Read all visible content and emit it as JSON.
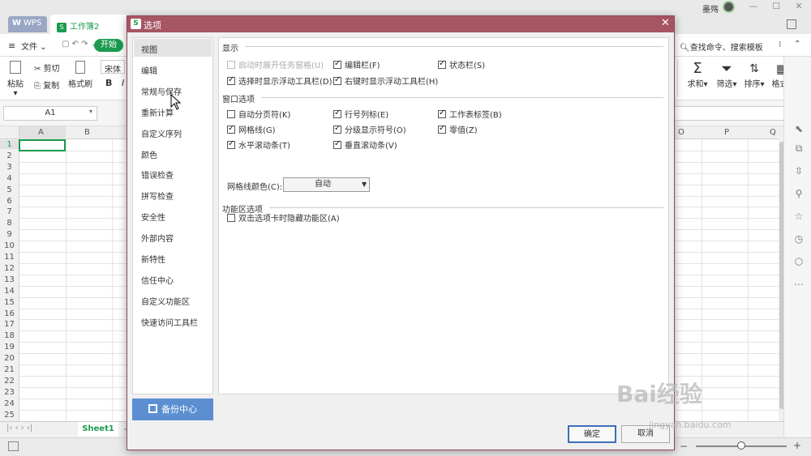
{
  "app": {
    "tab_wps": "WPS",
    "tab_workbook": "工作簿2",
    "user_name": "墨殇"
  },
  "menubar": {
    "file_label": "文件",
    "start_tab": "开始",
    "search_label": "查找命令、搜索模板"
  },
  "ribbon": {
    "paste": "粘贴",
    "cut": "剪切",
    "copy": "复制",
    "format_painter": "格式刷",
    "font_name": "宋体",
    "bold": "B",
    "italic": "I",
    "sum": "求和",
    "filter": "筛选",
    "sort": "排序",
    "format": "格式"
  },
  "formula_bar": {
    "cell_ref": "A1"
  },
  "grid": {
    "columns": [
      "A",
      "B",
      "O",
      "P",
      "Q"
    ],
    "rows": [
      "1",
      "2",
      "3",
      "4",
      "5",
      "6",
      "7",
      "8",
      "9",
      "10",
      "11",
      "12",
      "13",
      "14",
      "15",
      "16",
      "17",
      "18",
      "19",
      "20",
      "21",
      "22",
      "23",
      "24",
      "25"
    ]
  },
  "sheets": {
    "active": "Sheet1"
  },
  "dialog": {
    "title": "选项",
    "nav_items": [
      "视图",
      "编辑",
      "常规与保存",
      "重新计算",
      "自定义序列",
      "颜色",
      "错误检查",
      "拼写检查",
      "安全性",
      "外部内容",
      "新特性",
      "信任中心",
      "自定义功能区",
      "快速访问工具栏"
    ],
    "active_nav": "视图",
    "backup_label": "备份中心",
    "section_display": "显示",
    "section_window": "窗口选项",
    "section_ribbon": "功能区选项",
    "display_options": [
      {
        "label": "启动时展开任务窗格(U)",
        "checked": false,
        "disabled": true
      },
      {
        "label": "编辑栏(F)",
        "checked": true
      },
      {
        "label": "状态栏(S)",
        "checked": true
      },
      {
        "label": "选择时显示浮动工具栏(D)",
        "checked": true
      },
      {
        "label": "右键时显示浮动工具栏(H)",
        "checked": true
      }
    ],
    "window_options": [
      {
        "label": "自动分页符(K)",
        "checked": false
      },
      {
        "label": "行号列标(E)",
        "checked": true
      },
      {
        "label": "工作表标签(B)",
        "checked": true
      },
      {
        "label": "网格线(G)",
        "checked": true
      },
      {
        "label": "分级显示符号(O)",
        "checked": true
      },
      {
        "label": "零值(Z)",
        "checked": true
      },
      {
        "label": "水平滚动条(T)",
        "checked": true
      },
      {
        "label": "垂直滚动条(V)",
        "checked": true
      }
    ],
    "gridline_color_label": "网格线颜色(C):",
    "gridline_color_value": "自动",
    "ribbon_options": [
      {
        "label": "双击选项卡时隐藏功能区(A)",
        "checked": false
      }
    ],
    "ok_label": "确定",
    "cancel_label": "取消"
  },
  "watermark": {
    "brand": "Bai经验",
    "url": "jingyan.baidu.com"
  },
  "colors": {
    "wps_green": "#1a9b4e",
    "dialog_title": "#a65563",
    "backup_blue": "#5b8fd1"
  }
}
